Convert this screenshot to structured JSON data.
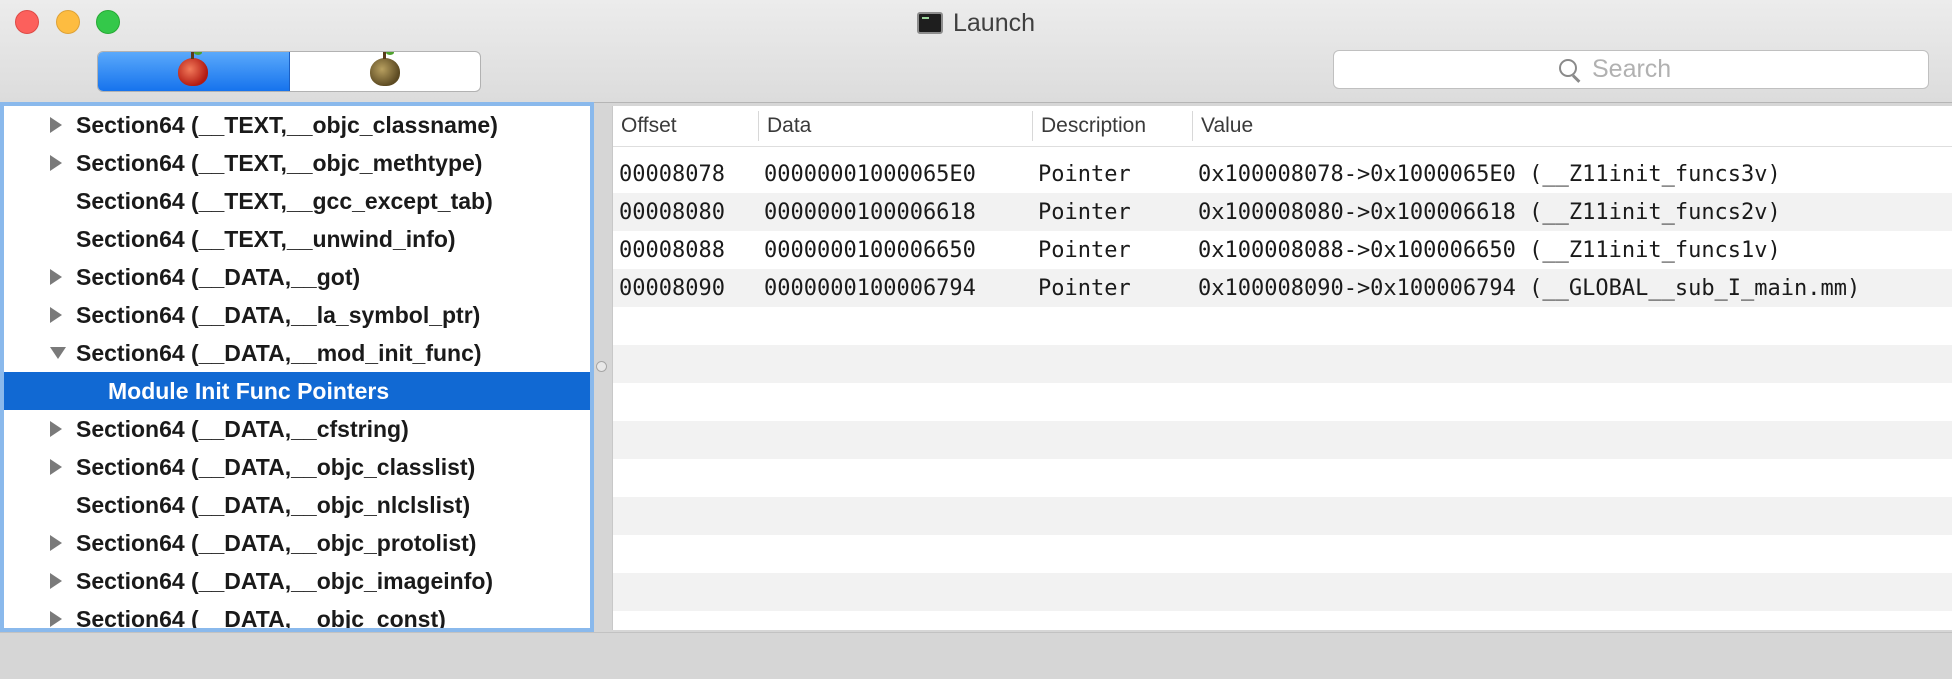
{
  "window": {
    "title": "Launch"
  },
  "toolbar": {
    "segments": [
      {
        "name": "red-apple",
        "active": true
      },
      {
        "name": "olive-apple",
        "active": false
      }
    ],
    "search": {
      "placeholder": "Search",
      "value": ""
    }
  },
  "tree": {
    "items": [
      {
        "label": "Section64 (__TEXT,__objc_classname)",
        "level": 1,
        "disclosure": "collapsed"
      },
      {
        "label": "Section64 (__TEXT,__objc_methtype)",
        "level": 1,
        "disclosure": "collapsed"
      },
      {
        "label": "Section64 (__TEXT,__gcc_except_tab)",
        "level": 1,
        "disclosure": "none"
      },
      {
        "label": "Section64 (__TEXT,__unwind_info)",
        "level": 1,
        "disclosure": "none"
      },
      {
        "label": "Section64 (__DATA,__got)",
        "level": 1,
        "disclosure": "collapsed"
      },
      {
        "label": "Section64 (__DATA,__la_symbol_ptr)",
        "level": 1,
        "disclosure": "collapsed"
      },
      {
        "label": "Section64 (__DATA,__mod_init_func)",
        "level": 1,
        "disclosure": "expanded"
      },
      {
        "label": "Module Init Func Pointers",
        "level": 2,
        "disclosure": "none",
        "selected": true
      },
      {
        "label": "Section64 (__DATA,__cfstring)",
        "level": 1,
        "disclosure": "collapsed"
      },
      {
        "label": "Section64 (__DATA,__objc_classlist)",
        "level": 1,
        "disclosure": "collapsed"
      },
      {
        "label": "Section64 (__DATA,__objc_nlclslist)",
        "level": 1,
        "disclosure": "none"
      },
      {
        "label": "Section64 (__DATA,__objc_protolist)",
        "level": 1,
        "disclosure": "collapsed"
      },
      {
        "label": "Section64 (__DATA,__objc_imageinfo)",
        "level": 1,
        "disclosure": "collapsed"
      },
      {
        "label": "Section64 (__DATA,__objc_const)",
        "level": 1,
        "disclosure": "collapsed"
      }
    ]
  },
  "table": {
    "columns": [
      "Offset",
      "Data",
      "Description",
      "Value"
    ],
    "rows": [
      [
        "00008078",
        "00000001000065E0",
        "Pointer",
        "0x100008078->0x1000065E0 (__Z11init_funcs3v)"
      ],
      [
        "00008080",
        "0000000100006618",
        "Pointer",
        "0x100008080->0x100006618 (__Z11init_funcs2v)"
      ],
      [
        "00008088",
        "0000000100006650",
        "Pointer",
        "0x100008088->0x100006650 (__Z11init_funcs1v)"
      ],
      [
        "00008090",
        "0000000100006794",
        "Pointer",
        "0x100008090->0x100006794 (__GLOBAL__sub_I_main.mm)"
      ]
    ]
  },
  "colors": {
    "selection": "#1169d3",
    "segment_active": "#1673ed",
    "tree_focus_ring": "#8ab9ec"
  }
}
